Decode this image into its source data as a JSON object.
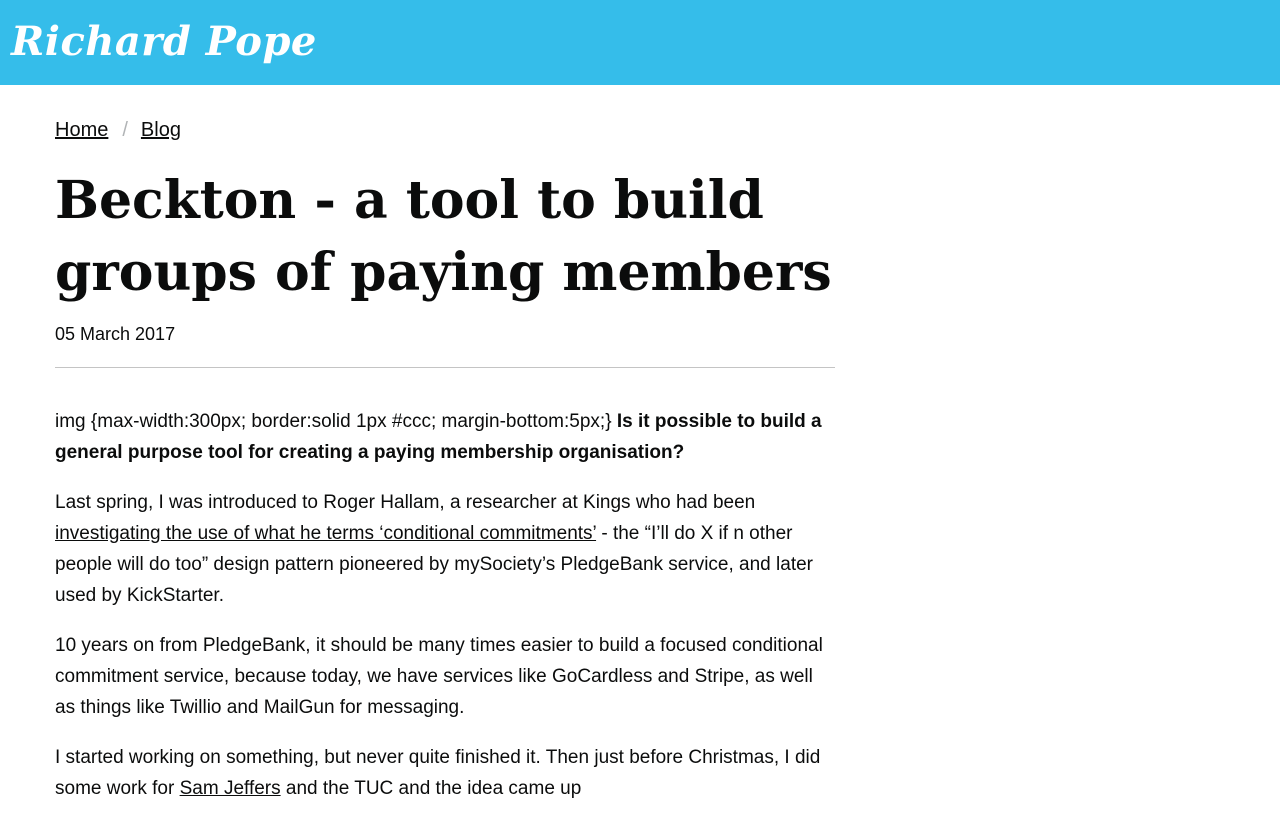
{
  "header": {
    "site_title": "Richard Pope",
    "background_color": "#35bdea"
  },
  "breadcrumb": {
    "home": "Home",
    "separator": "/",
    "blog": "Blog"
  },
  "post": {
    "title": "Beckton - a tool to build groups of paying members",
    "date": "05 March 2017",
    "p1_prefix": "img {max-width:300px; border:solid 1px #ccc; margin-bottom:5px;}",
    "p1_bold": "Is it possible to build a general purpose tool for creating a paying membership organisation?",
    "p2_before": "Last spring, I was introduced to Roger Hallam, a researcher at Kings who had been",
    "p2_link": "investigating the use of what he terms ‘conditional commitments’",
    "p2_after": "- the “I’ll do X if n other people will do too” design pattern pioneered by mySociety’s PledgeBank service, and later used by KickStarter.",
    "p3": "10 years on from PledgeBank, it should be many times easier to build a focused conditional commitment service, because today, we have services like GoCardless and Stripe, as well as things like Twillio and MailGun for messaging.",
    "p4_before": "I started working on something, but never quite finished it. Then just before Christmas, I did some work for",
    "p4_link": "Sam Jeffers",
    "p4_after": "and the TUC and the idea came up"
  }
}
